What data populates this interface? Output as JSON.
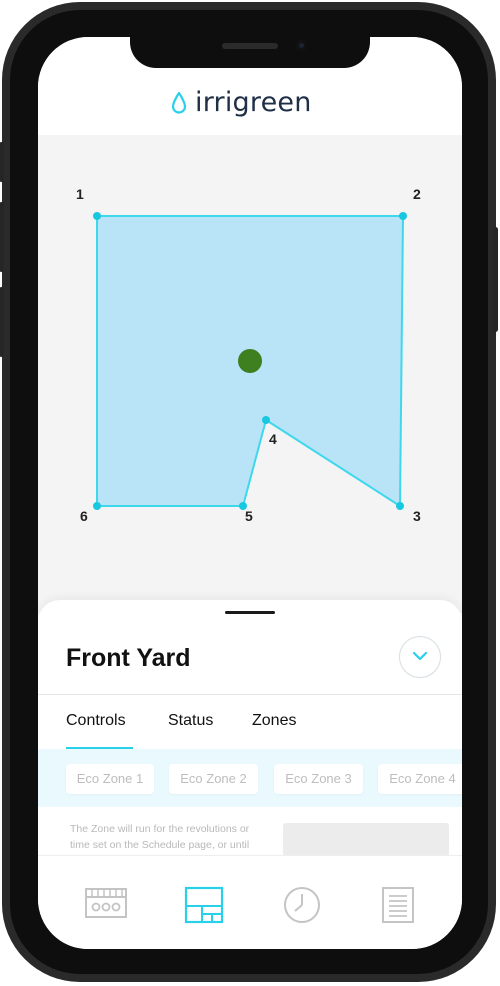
{
  "app": {
    "logo_text": "irrigreen"
  },
  "map": {
    "vertices": [
      {
        "label": "1"
      },
      {
        "label": "2"
      },
      {
        "label": "3"
      },
      {
        "label": "4"
      },
      {
        "label": "5"
      },
      {
        "label": "6"
      }
    ]
  },
  "zone": {
    "title": "Front Yard"
  },
  "tabs": [
    {
      "label": "Controls",
      "active": true
    },
    {
      "label": "Status",
      "active": false
    },
    {
      "label": "Zones",
      "active": false
    }
  ],
  "eco_zones": [
    "Eco Zone 1",
    "Eco Zone 2",
    "Eco Zone 3",
    "Eco Zone 4"
  ],
  "description": "The Zone will run for the revolutions or time set on the Schedule page, or until",
  "bottom_nav": [
    {
      "icon": "controller-icon",
      "active": false
    },
    {
      "icon": "map-layout-icon",
      "active": true
    },
    {
      "icon": "clock-icon",
      "active": false
    },
    {
      "icon": "document-icon",
      "active": false
    }
  ],
  "colors": {
    "accent": "#28d0ea",
    "polygon_fill": "#b9e3f7",
    "center_marker": "#3e7f1f",
    "logo_text": "#1f2f46"
  }
}
